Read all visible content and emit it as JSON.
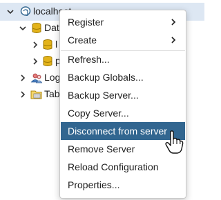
{
  "tree": {
    "root": {
      "label": "localhost",
      "icon": "elephant-server-icon"
    },
    "items": [
      {
        "label": "Dat",
        "icon": "databases-icon"
      },
      {
        "label": "l",
        "icon": "database-icon"
      },
      {
        "label": "p",
        "icon": "database-icon"
      },
      {
        "label": "Log",
        "icon": "login-roles-icon"
      },
      {
        "label": "Tab",
        "icon": "tablespaces-icon"
      }
    ]
  },
  "context_menu": {
    "items": [
      {
        "label": "Register",
        "submenu": true
      },
      {
        "label": "Create",
        "submenu": true
      },
      {
        "label": "Refresh..."
      },
      {
        "label": "Backup Globals..."
      },
      {
        "label": "Backup Server..."
      },
      {
        "label": "Copy Server..."
      },
      {
        "label": "Disconnect from server",
        "active": true
      },
      {
        "label": "Remove Server"
      },
      {
        "label": "Reload Configuration"
      },
      {
        "label": "Properties..."
      }
    ]
  },
  "colors": {
    "highlight": "#326690",
    "selection_bg": "#dde7f3"
  }
}
